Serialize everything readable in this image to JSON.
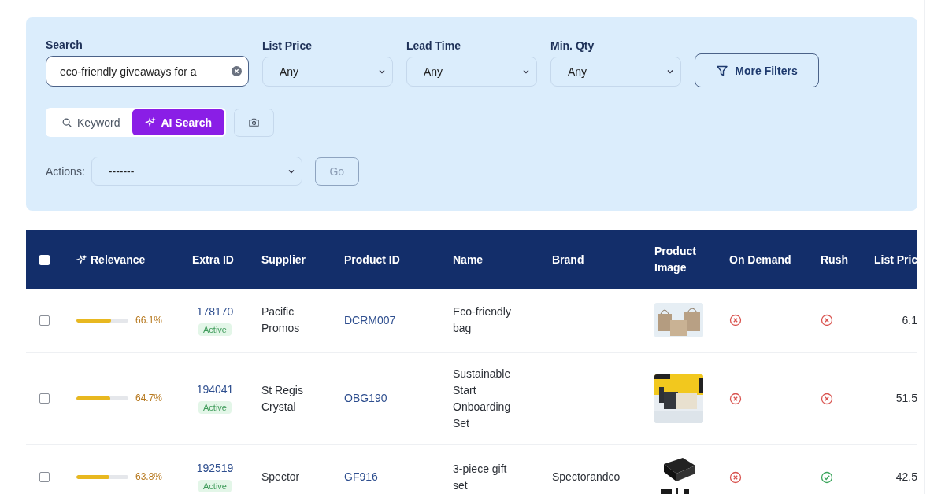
{
  "filters": {
    "search": {
      "label": "Search",
      "value": "eco-friendly giveaways for a"
    },
    "selects": [
      {
        "label": "List Price",
        "value": "Any"
      },
      {
        "label": "Lead Time",
        "value": "Any"
      },
      {
        "label": "Min. Qty",
        "value": "Any"
      }
    ],
    "more_filters": "More Filters",
    "modes": [
      {
        "kind": "keyword",
        "label": "Keyword",
        "selected": false
      },
      {
        "kind": "ai",
        "label": "AI Search",
        "selected": true
      }
    ],
    "actions": {
      "label": "Actions:",
      "value": "-------",
      "go": "Go",
      "go_disabled": true
    }
  },
  "table": {
    "select_all_checked": false,
    "columns": [
      "Relevance",
      "Extra ID",
      "Supplier",
      "Product ID",
      "Name",
      "Brand",
      "Product Image",
      "On Demand",
      "Rush",
      "List Pric"
    ],
    "rows": [
      {
        "checked": false,
        "level": 0.661,
        "relevance": "66.1%",
        "extra_id": "178170",
        "status": "Active",
        "supplier": "Pacific Promos",
        "product_id": "DCRM007",
        "name": "Eco-friendly bag",
        "on_demand": false,
        "rush": false,
        "list_price": "6.1"
      },
      {
        "checked": false,
        "level": 0.647,
        "relevance": "64.7%",
        "extra_id": "194041",
        "status": "Active",
        "supplier": "St Regis Crystal",
        "product_id": "OBG190",
        "name": "Sustainable Start Onboarding Set",
        "on_demand": false,
        "rush": false,
        "list_price": "51.5"
      },
      {
        "checked": false,
        "level": 0.638,
        "relevance": "63.8%",
        "extra_id": "192519",
        "status": "Active",
        "supplier": "Spector",
        "product_id": "GF916",
        "name": "3-piece gift set",
        "brand": "Spectorandco",
        "on_demand": false,
        "rush": true,
        "list_price": "42.5"
      }
    ]
  }
}
